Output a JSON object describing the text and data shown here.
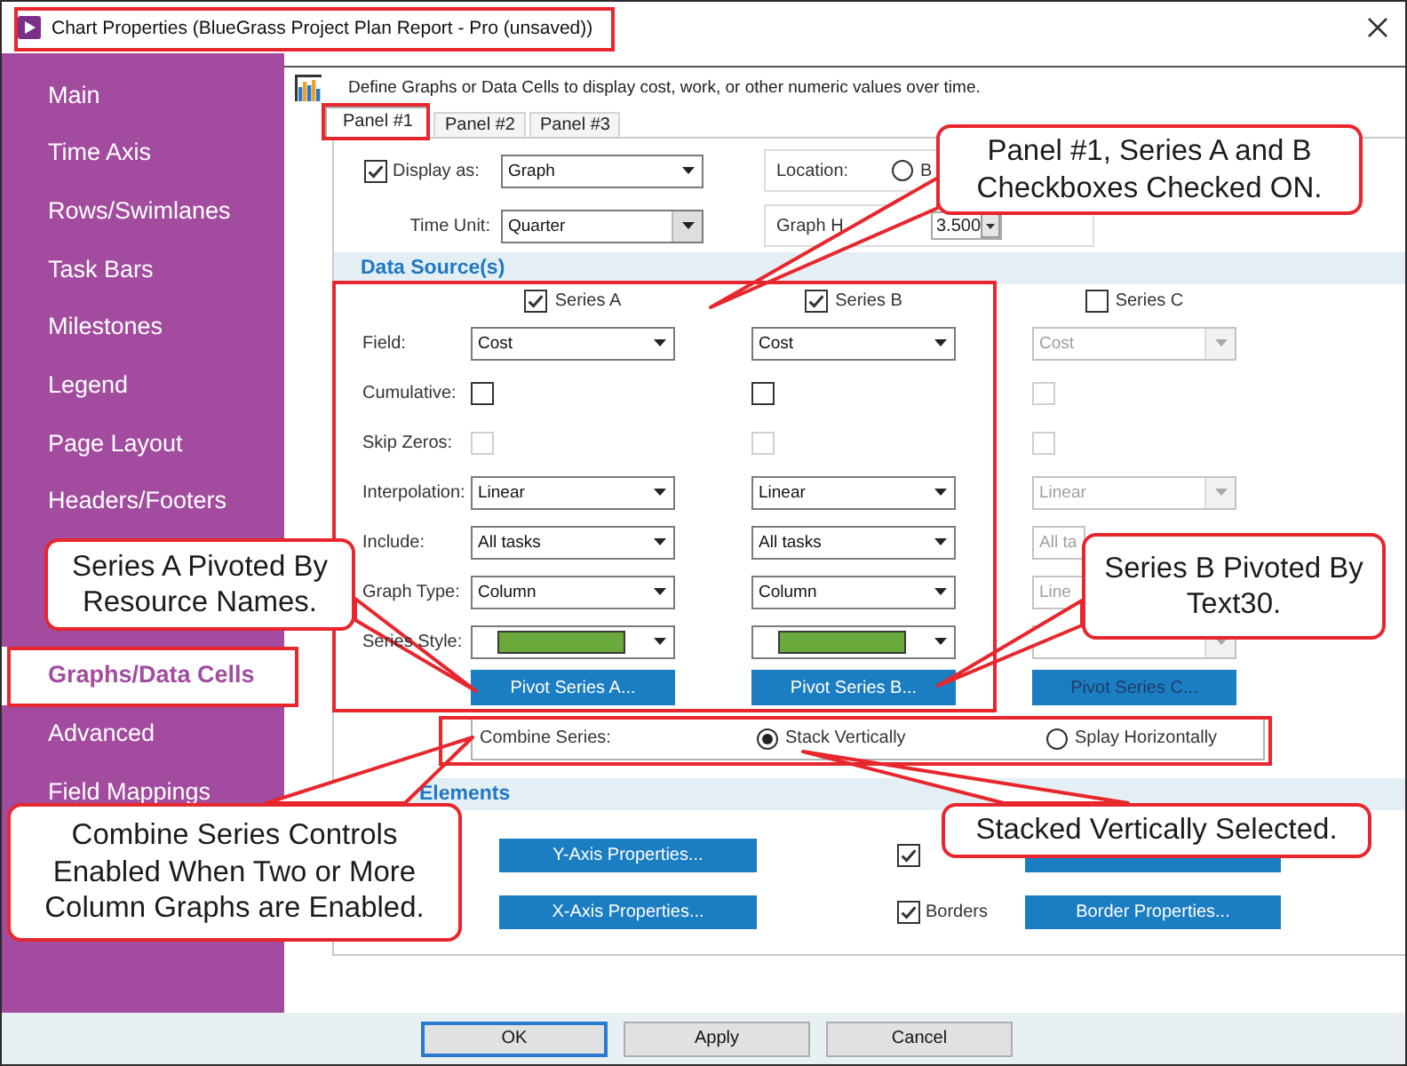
{
  "window": {
    "title": "Chart Properties (BlueGrass Project Plan Report - Pro (unsaved))"
  },
  "sidebar": {
    "items": [
      {
        "label": "Main",
        "selected": false
      },
      {
        "label": "Time Axis",
        "selected": false
      },
      {
        "label": "Rows/Swimlanes",
        "selected": false
      },
      {
        "label": "Task Bars",
        "selected": false
      },
      {
        "label": "Milestones",
        "selected": false
      },
      {
        "label": "Legend",
        "selected": false
      },
      {
        "label": "Page Layout",
        "selected": false
      },
      {
        "label": "Headers/Footers",
        "selected": false
      },
      {
        "label": "Graphs/Data Cells",
        "selected": true
      },
      {
        "label": "Advanced",
        "selected": false
      },
      {
        "label": "Field Mappings",
        "selected": false
      }
    ]
  },
  "header": {
    "description": "Define Graphs or Data Cells to display cost, work, or other numeric values over time."
  },
  "tabs": [
    {
      "label": "Panel #1",
      "selected": true
    },
    {
      "label": "Panel #2",
      "selected": false
    },
    {
      "label": "Panel #3",
      "selected": false
    }
  ],
  "display_as": {
    "label": "Display as:",
    "checked": true,
    "value": "Graph"
  },
  "time_unit": {
    "label": "Time Unit:",
    "value": "Quarter"
  },
  "location": {
    "label": "Location:",
    "options": [
      {
        "label": "B",
        "selected": false
      }
    ]
  },
  "graph_height": {
    "label": "Graph H",
    "value": "3.500"
  },
  "data_source": {
    "title": "Data Source(s)",
    "row_labels": [
      "Field:",
      "Cumulative:",
      "Skip Zeros:",
      "Interpolation:",
      "Include:",
      "Graph Type:",
      "Series Style:"
    ],
    "series": [
      {
        "name": "Series A",
        "checked": true,
        "cells": [
          {
            "kind": "dropdown",
            "value": "Cost",
            "disabled": false
          },
          {
            "kind": "checkbox",
            "checked": false,
            "disabled": false
          },
          {
            "kind": "checkbox",
            "checked": false,
            "disabled": true
          },
          {
            "kind": "dropdown",
            "value": "Linear",
            "disabled": false
          },
          {
            "kind": "dropdown",
            "value": "All tasks",
            "disabled": false
          },
          {
            "kind": "dropdown",
            "value": "Column",
            "disabled": false
          },
          {
            "kind": "swatch",
            "color": "#6aaa3c",
            "disabled": false
          }
        ],
        "pivot": {
          "label": "Pivot Series A...",
          "disabled": false
        }
      },
      {
        "name": "Series B",
        "checked": true,
        "cells": [
          {
            "kind": "dropdown",
            "value": "Cost",
            "disabled": false
          },
          {
            "kind": "checkbox",
            "checked": false,
            "disabled": false
          },
          {
            "kind": "checkbox",
            "checked": false,
            "disabled": true
          },
          {
            "kind": "dropdown",
            "value": "Linear",
            "disabled": false
          },
          {
            "kind": "dropdown",
            "value": "All tasks",
            "disabled": false
          },
          {
            "kind": "dropdown",
            "value": "Column",
            "disabled": false
          },
          {
            "kind": "swatch",
            "color": "#6aaa3c",
            "disabled": false
          }
        ],
        "pivot": {
          "label": "Pivot Series B...",
          "disabled": false
        }
      },
      {
        "name": "Series C",
        "checked": false,
        "cells": [
          {
            "kind": "dropdown",
            "value": "Cost",
            "disabled": true
          },
          {
            "kind": "checkbox",
            "checked": false,
            "disabled": true
          },
          {
            "kind": "checkbox",
            "checked": false,
            "disabled": true
          },
          {
            "kind": "dropdown",
            "value": "Linear",
            "disabled": true
          },
          {
            "kind": "dropdown",
            "value": "All ta",
            "disabled": true
          },
          {
            "kind": "dropdown",
            "value": "Line",
            "disabled": true
          },
          {
            "kind": "swatch",
            "disabled": true
          }
        ],
        "pivot": {
          "label": "Pivot Series C...",
          "disabled": true
        }
      }
    ]
  },
  "combine_series": {
    "label": "Combine Series:",
    "options": [
      {
        "label": "Stack Vertically",
        "selected": true
      },
      {
        "label": "Splay Horizontally",
        "selected": false
      }
    ]
  },
  "chart_elements": {
    "title": "Elements",
    "axis_buttons": [
      "Y-Axis Properties...",
      "X-Axis Properties..."
    ],
    "toggles": [
      {
        "checked": true
      },
      {
        "checked": true,
        "label": "Borders",
        "button": "Border Properties..."
      }
    ]
  },
  "buttons": [
    {
      "label": "OK",
      "default": true
    },
    {
      "label": "Apply",
      "default": false
    },
    {
      "label": "Cancel",
      "default": false
    }
  ],
  "callouts": [
    "Panel #1, Series A and B Checkboxes Checked ON.",
    "Series A Pivoted By Resource Names.",
    "Series B Pivoted By Text30.",
    "Combine Series Controls Enabled When Two or More Column Graphs are Enabled.",
    "Stacked Vertically Selected."
  ]
}
